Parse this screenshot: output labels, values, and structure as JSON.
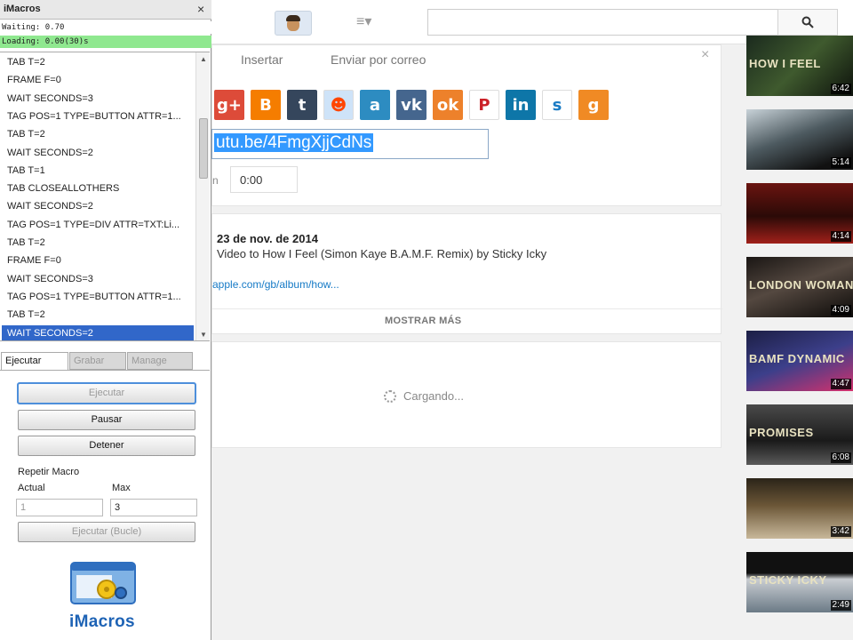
{
  "youtube": {
    "share_tabs": [
      "Insertar",
      "Enviar por correo"
    ],
    "share_icons": [
      {
        "name": "google-plus-icon",
        "glyph": "g+",
        "color": "#dd4b39"
      },
      {
        "name": "blogger-icon",
        "glyph": "B",
        "color": "#f57d00"
      },
      {
        "name": "tumblr-icon",
        "glyph": "t",
        "color": "#35465c"
      },
      {
        "name": "reddit-icon",
        "glyph": "☻",
        "color": "#cee3f8"
      },
      {
        "name": "ameba-icon",
        "glyph": "a",
        "color": "#2d8cc1"
      },
      {
        "name": "vk-icon",
        "glyph": "vk",
        "color": "#45668e"
      },
      {
        "name": "odnoklassniki-icon",
        "glyph": "ok",
        "color": "#ed812b"
      },
      {
        "name": "pinterest-icon",
        "glyph": "P",
        "color": "#ffffff"
      },
      {
        "name": "linkedin-icon",
        "glyph": "in",
        "color": "#0e76a8"
      },
      {
        "name": "stumbleupon-icon",
        "glyph": "s",
        "color": "#ffffff"
      },
      {
        "name": "goo-icon",
        "glyph": "g",
        "color": "#f08a24"
      }
    ],
    "share_url": "utu.be/4FmgXjjCdNs",
    "start_label": "n",
    "start_value": "0:00",
    "desc_date": "23 de nov. de 2014",
    "desc_text": "Video to How I Feel (Simon Kaye B.A.M.F. Remix) by Sticky Icky",
    "desc_link": "apple.com/gb/album/how...",
    "more_label": "MOSTRAR MÁS",
    "loading_text": "Cargando...",
    "thumbnails": [
      {
        "title": "HOW I FEEL",
        "duration": "6:42",
        "bg": "linear-gradient(135deg,#1b2a1e,#3f5a2e,#0d120c)"
      },
      {
        "title": "",
        "duration": "5:14",
        "bg": "linear-gradient(160deg,#c8d2d8,#4d5a60 45%,#111 85%)"
      },
      {
        "title": "",
        "duration": "4:14",
        "bg": "linear-gradient(180deg,#6a1410,#2b0a07 55%,#a0201a)"
      },
      {
        "title": "LONDON WOMAN",
        "duration": "4:09",
        "bg": "linear-gradient(160deg,#1a1614,#544840 45%,#0c0a08)"
      },
      {
        "title": "BAMF DYNAMIC",
        "duration": "4:47",
        "bg": "linear-gradient(160deg,#1c1f45,#3c3f8a 50%,#d5316d)"
      },
      {
        "title": "PROMISES",
        "duration": "6:08",
        "bg": "linear-gradient(180deg,#4a4a4a,#1a1a1a 60%,#5a5a5a)"
      },
      {
        "title": "",
        "duration": "3:42",
        "bg": "linear-gradient(180deg,#2b2418,#6b5637 45%,#c8b89a)"
      },
      {
        "title": "STICKY ICKY",
        "duration": "2:49",
        "bg": "linear-gradient(180deg,#111,#111 35%,#c9cdd2 45%,#6b7a86)"
      }
    ]
  },
  "imacros": {
    "title": "iMacros",
    "close_glyph": "×",
    "warning": "Waiting: 0.70",
    "loading": "Loading: 0.00(30)s",
    "macro_lines": [
      "TAB T=2",
      "FRAME F=0",
      "WAIT SECONDS=3",
      "TAG POS=1 TYPE=BUTTON ATTR=1...",
      "TAB T=2",
      "WAIT SECONDS=2",
      "TAB T=1",
      "TAB CLOSEALLOTHERS",
      "WAIT SECONDS=2",
      "TAG POS=1 TYPE=DIV ATTR=TXT:Li...",
      "TAB T=2",
      "FRAME F=0",
      "WAIT SECONDS=3",
      "TAG POS=1 TYPE=BUTTON ATTR=1...",
      "TAB T=2",
      "WAIT SECONDS=2"
    ],
    "selected_index": 15,
    "tabs": [
      "Ejecutar",
      "Grabar",
      "Manage"
    ],
    "btn_run": "Ejecutar",
    "btn_pause": "Pausar",
    "btn_stop": "Detener",
    "repeat_label": "Repetir Macro",
    "actual_label": "Actual",
    "max_label": "Max",
    "actual_value": "1",
    "max_value": "3",
    "btn_loop": "Ejecutar (Bucle)",
    "logo_text": "iMacros"
  }
}
